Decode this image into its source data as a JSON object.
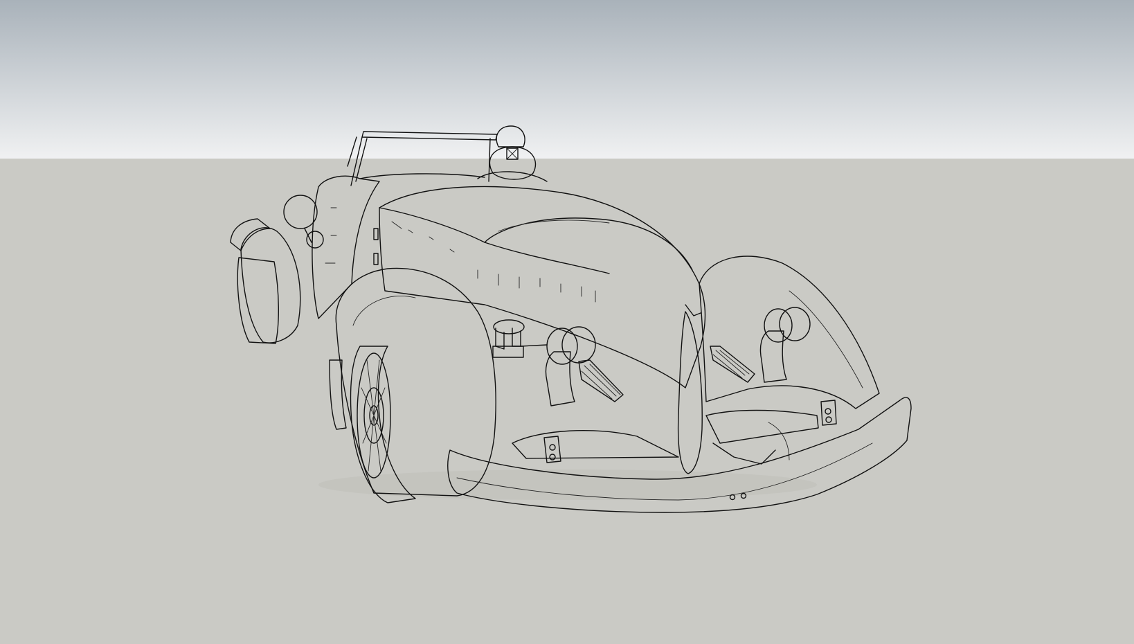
{
  "viewport": {
    "sky_top_color": "#a9b2ba",
    "sky_bottom_color": "#f0f1f2",
    "ground_color": "#cacac5",
    "model_fill": "#f4f4f4",
    "model_shade": "#c9c9c9",
    "edge_color": "#111111"
  },
  "scene": {
    "model": "classic-roadster-car",
    "figures": [
      "driver-figure"
    ],
    "style": "shaded-with-edges"
  }
}
